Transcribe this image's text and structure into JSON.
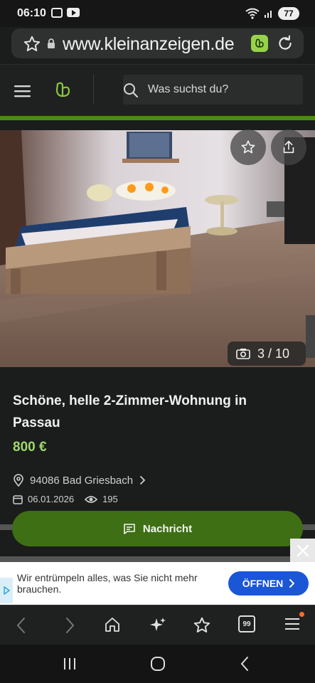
{
  "status_bar": {
    "time": "06:10",
    "battery": "77"
  },
  "browser": {
    "url": "www.kleinanzeigen.de"
  },
  "header": {
    "search_placeholder": "Was suchst du?"
  },
  "gallery": {
    "counter": "3 / 10",
    "current": 3,
    "total": 10
  },
  "listing": {
    "title": "Schöne, helle 2-Zimmer-Wohnung in Passau",
    "price": "800 €",
    "location": "94086 Bad Griesbach",
    "date": "06.01.2026",
    "views": "195"
  },
  "actions": {
    "message_label": "Nachricht"
  },
  "ad": {
    "text": "Wir entrümpeln alles, was Sie nicht mehr brauchen.",
    "cta_label": "ÖFFNEN"
  },
  "colors": {
    "accent_green": "#4a8a1a",
    "message_button": "#3e6f14",
    "price": "#9fd86a",
    "ad_cta": "#1a56d6"
  },
  "icons": [
    "star-icon",
    "lock-icon",
    "reload-icon",
    "menu-icon",
    "search-icon",
    "share-icon",
    "camera-icon",
    "location-pin-icon",
    "calendar-icon",
    "eye-icon",
    "chat-icon",
    "close-icon",
    "chevron-right-icon",
    "back-icon",
    "forward-icon",
    "home-icon",
    "sparkle-icon",
    "bookmarks-icon",
    "tabs-icon",
    "hamburger-icon",
    "recents-icon",
    "home-circle-icon",
    "system-back-icon"
  ],
  "bottom_nav": {
    "tabs_count": "99"
  }
}
